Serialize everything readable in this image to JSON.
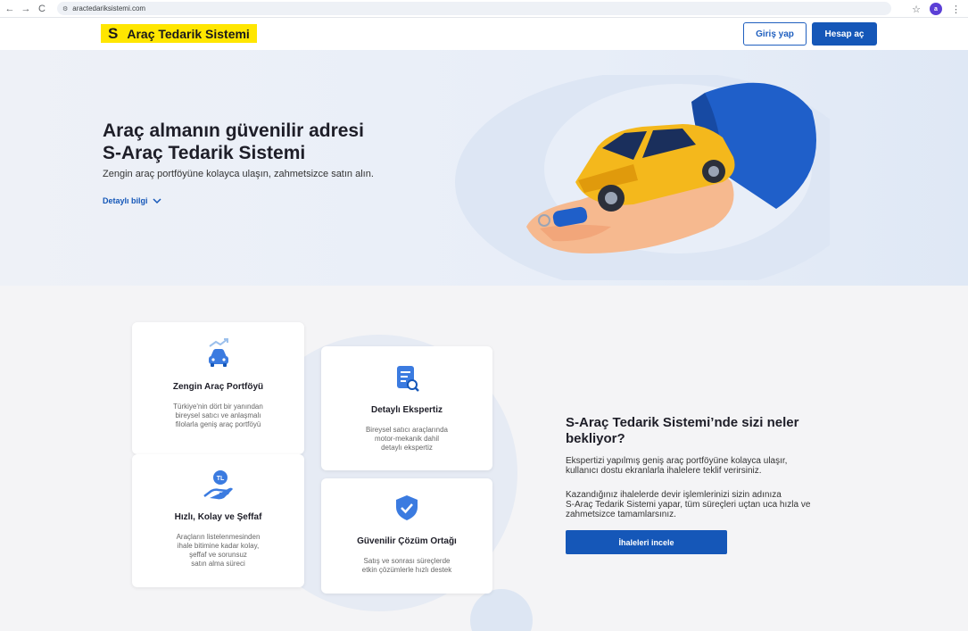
{
  "browser": {
    "url": "aractedariksistemi.com",
    "back_icon": "←",
    "forward_icon": "→",
    "reload_icon": "C",
    "profile_initial": "a"
  },
  "header": {
    "logo_mark": "S",
    "logo_name": "Araç Tedarik Sistemi",
    "login_label": "Giriş yap",
    "register_label": "Hesap aç"
  },
  "hero": {
    "title_line1": "Araç almanın güvenilir adresi",
    "title_line2": "S-Araç Tedarik Sistemi",
    "subtitle": "Zengin araç portföyüne kolayca ulaşın, zahmetsizce satın alın.",
    "more_label": "Detaylı bilgi"
  },
  "features": [
    {
      "title": "Zengin Araç Portföyü",
      "lines": [
        "Türkiye'nin dört bir yanından",
        "bireysel satıcı ve anlaşmalı",
        "filolarla geniş araç portföyü"
      ]
    },
    {
      "title": "Detaylı Ekspertiz",
      "lines": [
        "Bireysel satıcı araçlarında",
        "motor-mekanik dahil",
        "detaylı ekspertiz"
      ]
    },
    {
      "title": "Hızlı, Kolay ve Şeffaf",
      "badge": "TL",
      "lines": [
        "Araçların listelenmesinden",
        "ihale bitimine kadar kolay,",
        "şeffaf ve sorunsuz",
        "satın alma süreci"
      ]
    },
    {
      "title": "Güvenilir Çözüm Ortağı",
      "lines": [
        "Satış ve sonrası süreçlerde",
        "etkin çözümlerle hızlı destek"
      ]
    }
  ],
  "info": {
    "title_line1": "S-Araç Tedarik Sistemi’nde sizi neler",
    "title_line2": "bekliyor?",
    "p1_line1": "Ekspertizi yapılmış geniş araç portföyüne kolayca ulaşır,",
    "p1_line2": "kullanıcı dostu ekranlarla ihalelere teklif verirsiniz.",
    "p2_line1": "Kazandığınız ihalelerde devir işlemlerinizi sizin adınıza",
    "p2_line2": "S-Araç Tedarik Sistemi yapar, tüm süreçleri uçtan uca hızla ve",
    "p2_line3": "zahmetsizce tamamlarsınız.",
    "cta_label": "İhaleleri incele"
  },
  "colors": {
    "brand_yellow": "#ffe600",
    "primary_blue": "#1557b8",
    "accent_blue": "#3b7be0"
  }
}
